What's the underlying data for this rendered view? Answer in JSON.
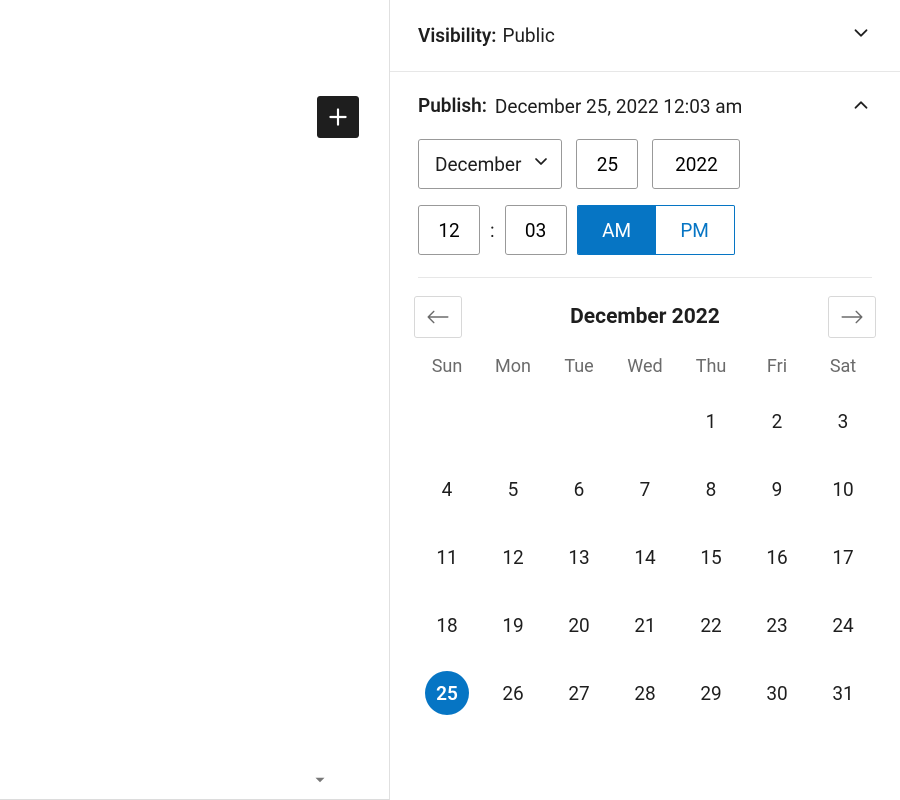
{
  "visibility": {
    "label": "Visibility:",
    "value": "Public"
  },
  "publish": {
    "label": "Publish:",
    "value": "December 25, 2022 12:03 am"
  },
  "datetime": {
    "month_selected": "December",
    "day": "25",
    "year": "2022",
    "hour": "12",
    "minute": "03",
    "am_label": "AM",
    "pm_label": "PM",
    "period_selected": "AM"
  },
  "calendar": {
    "title": "December 2022",
    "dow": [
      "Sun",
      "Mon",
      "Tue",
      "Wed",
      "Thu",
      "Fri",
      "Sat"
    ],
    "blanks_before": 4,
    "days_in_month": 31,
    "selected_day": 25
  }
}
